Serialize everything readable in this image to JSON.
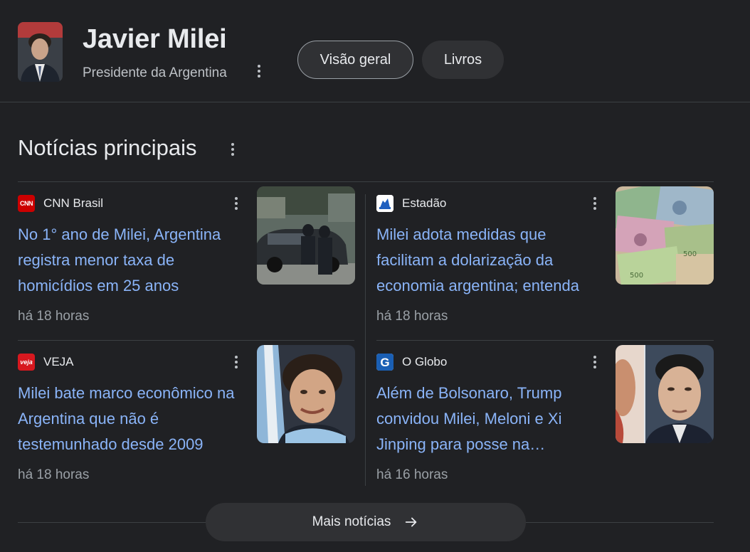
{
  "header": {
    "title": "Javier Milei",
    "subtitle": "Presidente da Argentina",
    "avatar_icon": "person-portrait-icon",
    "tabs": [
      {
        "label": "Visão geral",
        "active": true
      },
      {
        "label": "Livros",
        "active": false
      }
    ]
  },
  "section": {
    "title": "Notícias principais"
  },
  "news": [
    {
      "source": "CNN Brasil",
      "logo_text": "CNN",
      "logo_color": "#cc0000",
      "headline": "No 1° ano de Milei, Argentina registra menor taxa de homicídios em 25 anos",
      "time": "há 18 horas",
      "thumb_icon": "police-car-photo"
    },
    {
      "source": "Estadão",
      "logo_text": "",
      "logo_color": "#ffffff",
      "headline": "Milei adota medidas que facilitam a dolarização da economia argentina; entenda",
      "time": "há 18 horas",
      "thumb_icon": "banknotes-photo"
    },
    {
      "source": "VEJA",
      "logo_text": "veja",
      "logo_color": "#d7181f",
      "headline": "Milei bate marco econômico na Argentina que não é testemunhado desde 2009",
      "time": "há 18 horas",
      "thumb_icon": "milei-smiling-photo"
    },
    {
      "source": "O Globo",
      "logo_text": "G",
      "logo_color": "#ffffff",
      "headline": "Além de Bolsonaro, Trump convidou Milei, Meloni e Xi Jinping para posse na…",
      "time": "há 16 horas",
      "thumb_icon": "xi-jinping-photo"
    }
  ],
  "more_button": {
    "label": "Mais notícias",
    "icon": "arrow-right-icon"
  },
  "colors": {
    "background": "#202124",
    "link": "#8ab4f8",
    "text": "#e8eaed",
    "muted": "#9aa0a6"
  }
}
